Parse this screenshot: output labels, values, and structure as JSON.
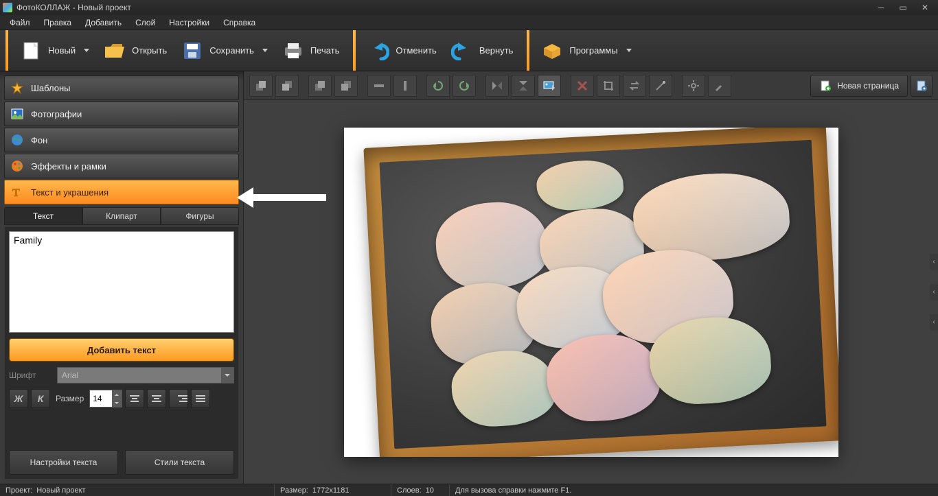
{
  "title": "ФотоКОЛЛАЖ - Новый проект",
  "menu": [
    "Файл",
    "Правка",
    "Добавить",
    "Слой",
    "Настройки",
    "Справка"
  ],
  "toolbar": {
    "new": "Новый",
    "open": "Открыть",
    "save": "Сохранить",
    "print": "Печать",
    "undo": "Отменить",
    "redo": "Вернуть",
    "programs": "Программы"
  },
  "sidebar": {
    "items": [
      {
        "label": "Шаблоны",
        "icon": "star"
      },
      {
        "label": "Фотографии",
        "icon": "photo"
      },
      {
        "label": "Фон",
        "icon": "globe"
      },
      {
        "label": "Эффекты и рамки",
        "icon": "fx"
      },
      {
        "label": "Текст и украшения",
        "icon": "text"
      }
    ],
    "activeIndex": 4
  },
  "subtabs": [
    "Текст",
    "Клипарт",
    "Фигуры"
  ],
  "subtabActive": 0,
  "textPanel": {
    "value": "Family",
    "addButton": "Добавить текст",
    "fontLabel": "Шрифт",
    "fontValue": "Arial",
    "sizeLabel": "Размер",
    "sizeValue": "14",
    "bold": "Ж",
    "italic": "К",
    "settingsButton": "Настройки текста",
    "stylesButton": "Стили текста"
  },
  "canvasToolbar": {
    "newPage": "Новая страница"
  },
  "status": {
    "projectLabel": "Проект:",
    "projectValue": "Новый проект",
    "sizeLabel": "Размер:",
    "sizeValue": "1772x1181",
    "layersLabel": "Слоев:",
    "layersValue": "10",
    "help": "Для вызова справки нажмите F1."
  }
}
